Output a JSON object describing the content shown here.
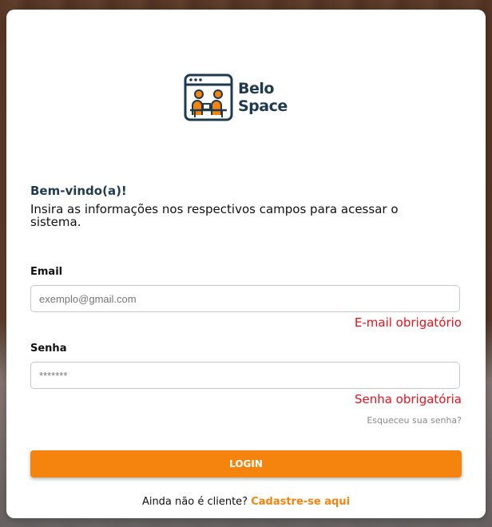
{
  "brand": {
    "line1": "Belo",
    "line2": "Space",
    "primary_color": "#1e3a4f",
    "accent_color": "#f5840f"
  },
  "welcome": {
    "title": "Bem-vindo(a)!",
    "subtitle": "Insira as informações nos respectivos campos para acessar o sistema."
  },
  "form": {
    "email": {
      "label": "Email",
      "value": "",
      "placeholder": "exemplo@gmail.com",
      "error": "E-mail obrigatório"
    },
    "password": {
      "label": "Senha",
      "value": "",
      "placeholder": "*******",
      "error": "Senha obrigatória"
    },
    "forgot_label": "Esqueceu sua senha?",
    "login_label": "LOGIN"
  },
  "signup": {
    "prompt": "Ainda não é cliente?",
    "link_label": "Cadastre-se aqui"
  },
  "colors": {
    "error": "#e8101a",
    "button": "#f5840f"
  }
}
